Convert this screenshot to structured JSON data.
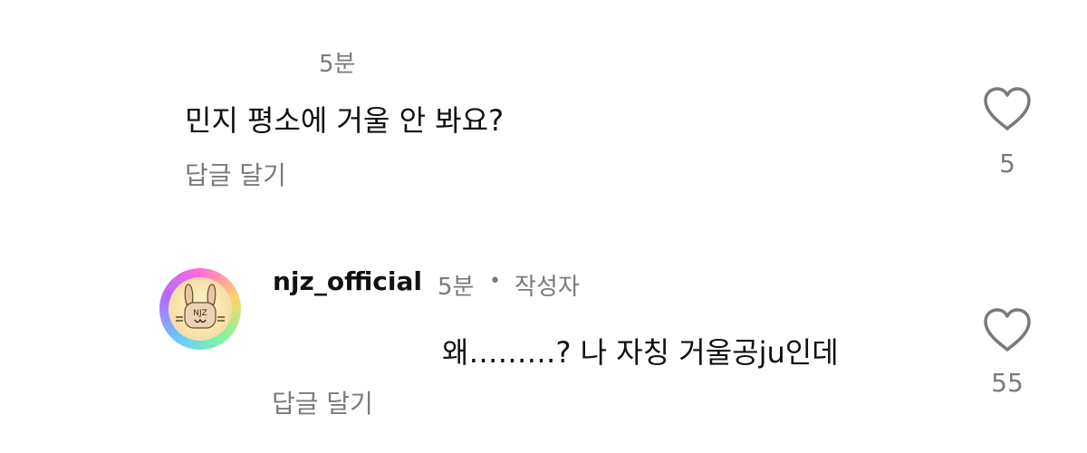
{
  "comments": [
    {
      "timestamp": "5분",
      "text": "민지 평소에 거울 안 봐요?",
      "reply_label": "답글 달기",
      "like_count": "5",
      "like_icon": "heart-outline-icon"
    },
    {
      "username": "njz_official",
      "timestamp": "5분",
      "separator": "•",
      "author_badge": "작성자",
      "text": "왜………? 나 자칭 거울공ju인데",
      "reply_label": "답글 달기",
      "like_count": "55",
      "like_icon": "heart-outline-icon",
      "avatar_text": "NJZ"
    }
  ],
  "colors": {
    "text": "#111111",
    "muted": "#7a7a7a",
    "background": "#ffffff"
  }
}
